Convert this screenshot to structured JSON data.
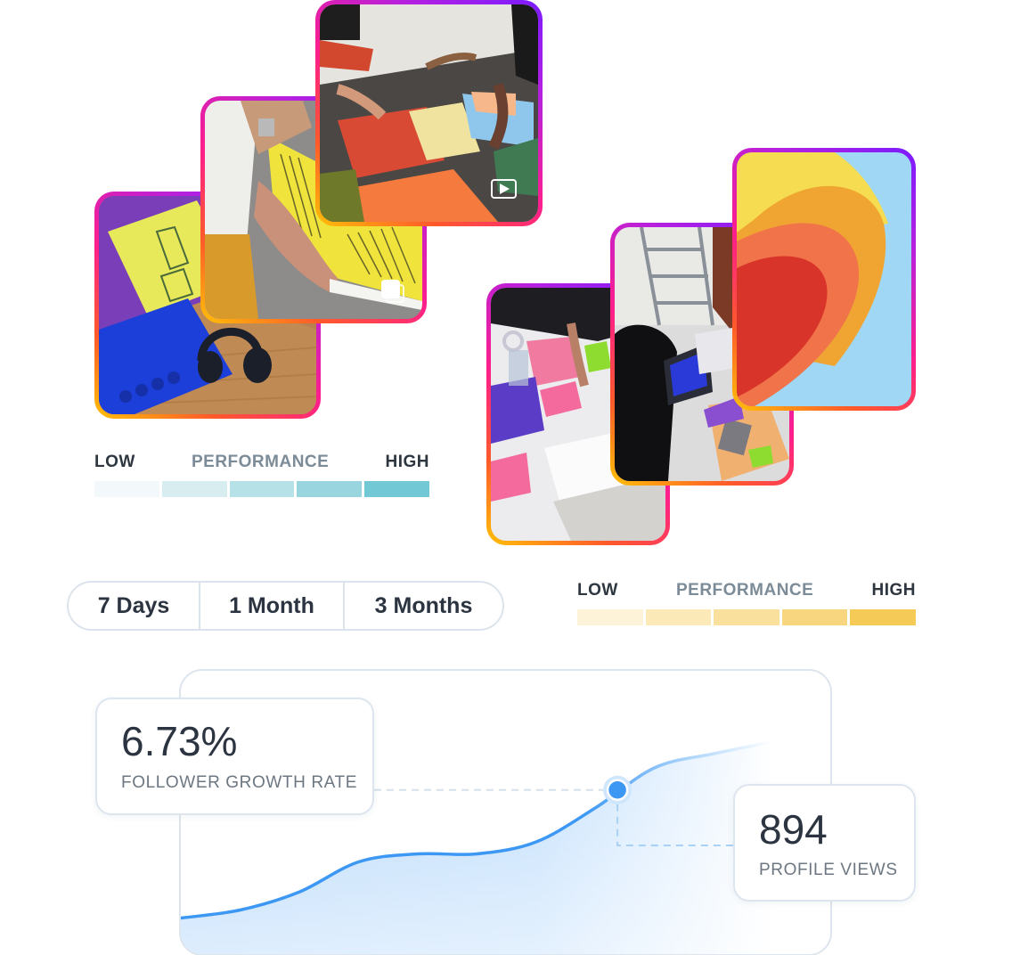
{
  "posts": [
    {
      "id": "card-a",
      "subject": "yellow zine and blue notebook with headphones on wooden desk",
      "media_type": "image"
    },
    {
      "id": "card-b",
      "subject": "hand flipping yellow printed magazine pages",
      "media_type": "carousel",
      "icon": "carousel-icon"
    },
    {
      "id": "card-c",
      "subject": "hands arranging colorful paper swatches on dark table",
      "media_type": "video",
      "icon": "video-play-icon"
    },
    {
      "id": "card-d",
      "subject": "sticky notes, scissors and sketches on a work table",
      "media_type": "image"
    },
    {
      "id": "card-e",
      "subject": "designers working on laptops and tablet",
      "media_type": "image"
    },
    {
      "id": "card-f",
      "subject": "curled yellow, orange and red paper on blue background",
      "media_type": "image"
    }
  ],
  "performance_legends": [
    {
      "low": "LOW",
      "title": "PERFORMANCE",
      "high": "HIGH",
      "colors": [
        "#f3f8fa",
        "#d7edf0",
        "#b6e1e7",
        "#98d5de",
        "#72c8d4"
      ]
    },
    {
      "low": "LOW",
      "title": "PERFORMANCE",
      "high": "HIGH",
      "colors": [
        "#fdf3d8",
        "#fbe9b7",
        "#f9e09d",
        "#f8d67f",
        "#f6ca57"
      ]
    }
  ],
  "period_toggle": {
    "options": [
      "7 Days",
      "1 Month",
      "3 Months"
    ]
  },
  "stats": {
    "growth": {
      "value": "6.73%",
      "label": "FOLLOWER GROWTH RATE"
    },
    "views": {
      "value": "894",
      "label": "PROFILE VIEWS"
    }
  },
  "colors": {
    "line": "#3d98f4",
    "marker": "#3d98f4",
    "border": "#dde5ee"
  },
  "chart_data": {
    "type": "area",
    "title": "",
    "xlabel": "",
    "ylabel": "",
    "x": [
      0,
      1,
      2,
      3,
      4,
      5,
      6,
      7,
      8,
      9,
      10
    ],
    "values": [
      10,
      14,
      23,
      38,
      42,
      42,
      48,
      65,
      85,
      92,
      98
    ],
    "ylim": [
      0,
      120
    ],
    "highlight_index": 7.4,
    "grid": false,
    "legend": "none",
    "annotations": [
      "6.73% FOLLOWER GROWTH RATE",
      "894 PROFILE VIEWS"
    ]
  }
}
